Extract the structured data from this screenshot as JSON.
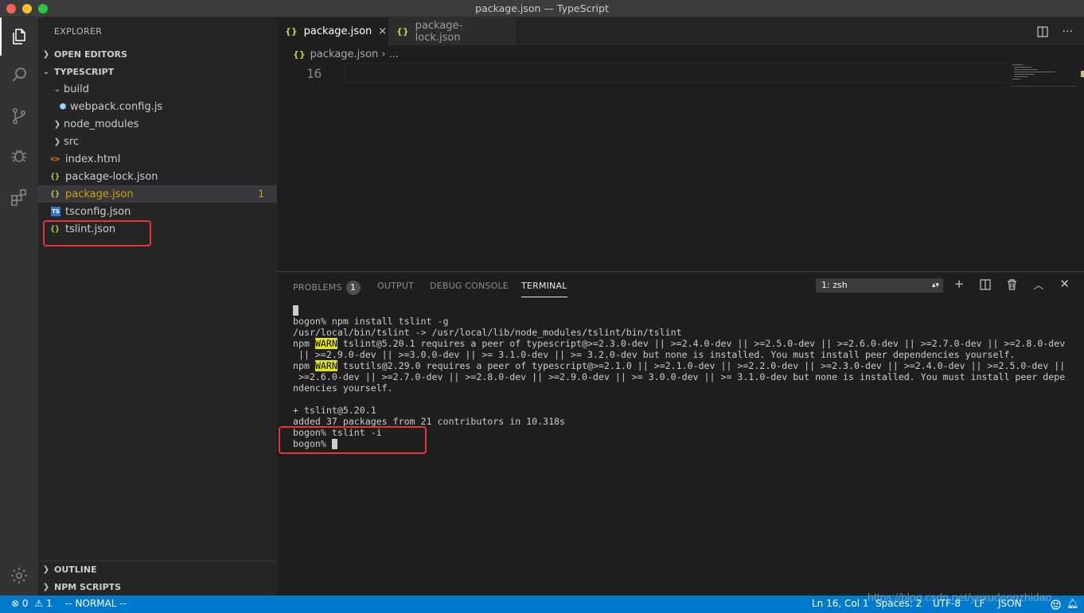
{
  "window": {
    "title": "package.json — TypeScript"
  },
  "sidebar": {
    "title": "EXPLORER",
    "sections": {
      "open_editors": "OPEN EDITORS",
      "project": "TYPESCRIPT",
      "outline": "OUTLINE",
      "npm_scripts": "NPM SCRIPTS"
    },
    "tree": [
      {
        "label": "build"
      },
      {
        "label": "webpack.config.js"
      },
      {
        "label": "node_modules"
      },
      {
        "label": "src"
      },
      {
        "label": "index.html"
      },
      {
        "label": "package-lock.json"
      },
      {
        "label": "package.json",
        "badge": "1"
      },
      {
        "label": "tsconfig.json"
      },
      {
        "label": "tslint.json"
      }
    ]
  },
  "tabs": [
    {
      "label": "package.json",
      "close": "×"
    },
    {
      "label": "package-lock.json"
    }
  ],
  "breadcrumb": {
    "file": "package.json",
    "rest": "› ..."
  },
  "editor": {
    "line_number": "16"
  },
  "panel": {
    "tabs": {
      "problems": "PROBLEMS",
      "problems_count": "1",
      "output": "OUTPUT",
      "debug": "DEBUG CONSOLE",
      "terminal": "TERMINAL"
    },
    "terminal_selector": "1: zsh"
  },
  "terminal": {
    "lines": [
      "bogon% npm install tslint -g",
      "/usr/local/bin/tslint -> /usr/local/lib/node_modules/tslint/bin/tslint"
    ],
    "npm": "npm",
    "warn": "WARN",
    "warn1": [
      " tslint@5.20.1 requires a peer of typescript@>=2.3.0-dev || >=2.4.0-dev || >=2.5.0-dev || >=2.6.0-dev || >=2.7.0-dev || >=2.8.0-dev",
      " || >=2.9.0-dev || >=3.0.0-dev || >= 3.1.0-dev || >= 3.2.0-dev but none is installed. You must install peer dependencies yourself."
    ],
    "warn2": [
      " tsutils@2.29.0 requires a peer of typescript@>=2.1.0 || >=2.1.0-dev || >=2.2.0-dev || >=2.3.0-dev || >=2.4.0-dev || >=2.5.0-dev ||",
      " >=2.6.0-dev || >=2.7.0-dev || >=2.8.0-dev || >=2.9.0-dev || >= 3.0.0-dev || >= 3.1.0-dev but none is installed. You must install peer depe",
      "ndencies yourself."
    ],
    "result": [
      "+ tslint@5.20.1",
      "added 37 packages from 21 contributors in 10.318s",
      "bogon% tslint -i",
      "bogon% "
    ]
  },
  "statusbar": {
    "errors": "0",
    "warnings": "1",
    "mode": "-- NORMAL --",
    "position": "Ln 16, Col 1",
    "spaces": "Spaces: 2",
    "encoding": "UTF-8",
    "eol": "LF",
    "language": "JSON"
  },
  "watermark": "https://blog.csdn.net/yexudengzhidao",
  "colors": {
    "accent": "#007acc",
    "highlight_box": "#e8323c",
    "warn_bg": "#e5e510"
  }
}
